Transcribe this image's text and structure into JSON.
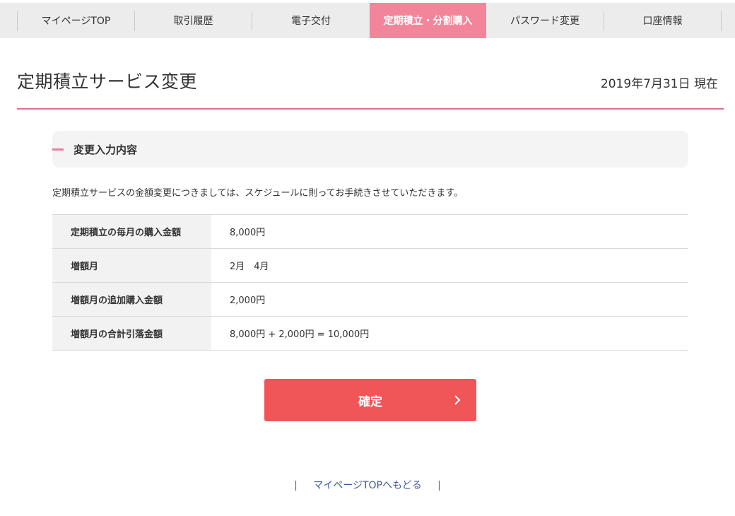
{
  "nav": {
    "tabs": [
      {
        "label": "マイページTOP",
        "active": false
      },
      {
        "label": "取引履歴",
        "active": false
      },
      {
        "label": "電子交付",
        "active": false
      },
      {
        "label": "定期積立・分割購入",
        "active": true
      },
      {
        "label": "パスワード変更",
        "active": false
      },
      {
        "label": "口座情報",
        "active": false
      }
    ]
  },
  "page": {
    "title": "定期積立サービス変更",
    "date": "2019年7月31日 現在"
  },
  "section": {
    "title": "変更入力内容",
    "description": "定期積立サービスの金額変更につきましては、スケジュールに則ってお手続きさせていただきます。"
  },
  "table": {
    "rows": [
      {
        "label": "定期積立の毎月の購入金額",
        "value": "8,000円"
      },
      {
        "label": "増額月",
        "value": "2月　4月"
      },
      {
        "label": "増額月の追加購入金額",
        "value": "2,000円"
      },
      {
        "label": "増額月の合計引落金額",
        "value": "8,000円 + 2,000円 = 10,000円"
      }
    ]
  },
  "confirm": {
    "label": "確定"
  },
  "footer": {
    "separator": "|",
    "back_label": "マイページTOPへもどる"
  },
  "colors": {
    "accent_pink": "#f3859a",
    "rule_pink": "#e0718d",
    "button_red": "#f05558",
    "link_blue": "#3d5aa6"
  },
  "icons": {
    "confirm": "chevron-right-icon",
    "section": "dash-marker"
  }
}
